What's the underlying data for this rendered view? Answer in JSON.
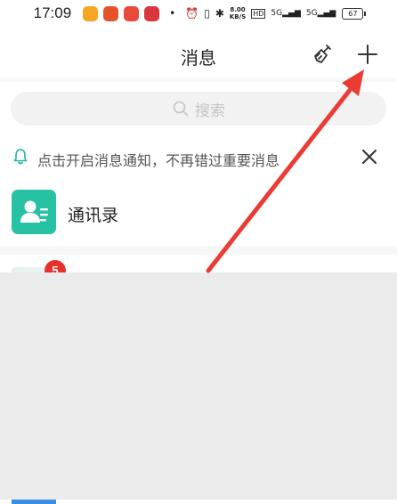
{
  "status_bar": {
    "time": "17:09",
    "dot": "•",
    "net_speed_value": "8.00",
    "net_speed_unit": "KB/S",
    "hd_label": "HD",
    "signal_1": "5G",
    "signal_2": "5G",
    "battery": "67"
  },
  "header": {
    "title": "消息"
  },
  "search": {
    "placeholder": "搜索"
  },
  "notice": {
    "text": "点击开启消息通知，不再错过重要消息"
  },
  "contacts": {
    "label": "通讯录"
  },
  "conversation": {
    "badge_count": "5"
  },
  "colors": {
    "accent": "#27c2a3",
    "badge": "#e8312d",
    "arrow": "#ea3b35"
  }
}
